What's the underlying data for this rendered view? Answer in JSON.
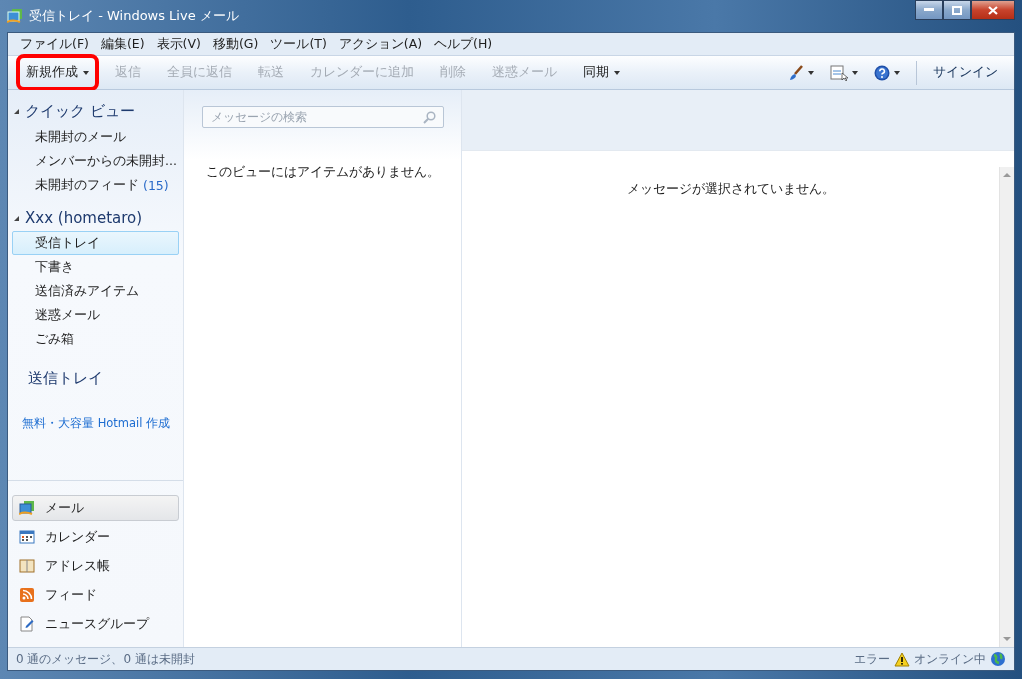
{
  "window": {
    "title": "受信トレイ - Windows Live メール"
  },
  "menu": [
    "ファイル(F)",
    "編集(E)",
    "表示(V)",
    "移動(G)",
    "ツール(T)",
    "アクション(A)",
    "ヘルプ(H)"
  ],
  "toolbar": [
    {
      "label": "新規作成",
      "disabled": false,
      "dropdown": true,
      "highlighted": true
    },
    {
      "label": "返信",
      "disabled": true,
      "dropdown": false,
      "highlighted": false
    },
    {
      "label": "全員に返信",
      "disabled": true,
      "dropdown": false,
      "highlighted": false
    },
    {
      "label": "転送",
      "disabled": true,
      "dropdown": false,
      "highlighted": false
    },
    {
      "label": "カレンダーに追加",
      "disabled": true,
      "dropdown": false,
      "highlighted": false
    },
    {
      "label": "削除",
      "disabled": true,
      "dropdown": false,
      "highlighted": false
    },
    {
      "label": "迷惑メール",
      "disabled": true,
      "dropdown": false,
      "highlighted": false
    },
    {
      "label": "同期",
      "disabled": false,
      "dropdown": true,
      "highlighted": false
    }
  ],
  "toolbar_right": {
    "sign_in": "サインイン"
  },
  "sidebar": {
    "sections": [
      {
        "title": "クイック ビュー",
        "expanded": true,
        "items": [
          {
            "label": "未開封のメール",
            "selected": false
          },
          {
            "label": "メンバーからの未開封...",
            "selected": false
          },
          {
            "label": "未開封のフィード",
            "count": "(15)",
            "selected": false
          }
        ]
      },
      {
        "title": "Xxx (hometaro)",
        "expanded": true,
        "items": [
          {
            "label": "受信トレイ",
            "selected": true
          },
          {
            "label": "下書き",
            "selected": false
          },
          {
            "label": "送信済みアイテム",
            "selected": false
          },
          {
            "label": "迷惑メール",
            "selected": false
          },
          {
            "label": "ごみ箱",
            "selected": false
          }
        ]
      }
    ],
    "outbox": "送信トレイ",
    "link": "無料・大容量 Hotmail 作成",
    "nav": [
      {
        "kind": "mail",
        "label": "メール",
        "selected": true
      },
      {
        "kind": "calendar",
        "label": "カレンダー",
        "selected": false
      },
      {
        "kind": "contacts",
        "label": "アドレス帳",
        "selected": false
      },
      {
        "kind": "feeds",
        "label": "フィード",
        "selected": false
      },
      {
        "kind": "newsgroups",
        "label": "ニュースグループ",
        "selected": false
      }
    ]
  },
  "message_list": {
    "search": {
      "placeholder": "メッセージの検索"
    },
    "empty_text": "このビューにはアイテムがありません。"
  },
  "reading_pane": {
    "empty_text": "メッセージが選択されていません。"
  },
  "status_bar": {
    "left": "0 通のメッセージ、0 通は未開封",
    "error": "エラー",
    "online": "オンライン中"
  }
}
